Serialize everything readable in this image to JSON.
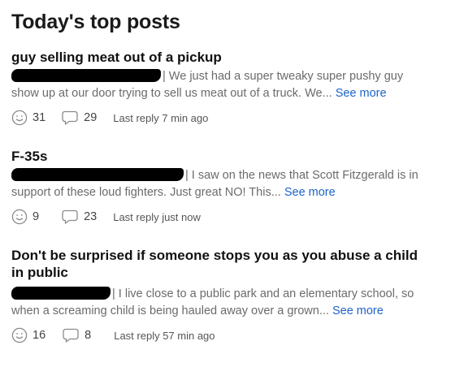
{
  "page": {
    "title": "Today's top posts"
  },
  "posts": [
    {
      "title": "guy selling meat out of a pickup",
      "separator": "|",
      "excerpt_line1": " We just had a super tweaky super pushy guy",
      "excerpt_line2": "show up at our door trying to sell us meat out of a truck. We...",
      "see_more": "See more",
      "reactions": "31",
      "comments": "29",
      "last_reply": "Last reply 7 min ago"
    },
    {
      "title": "F-35s",
      "separator": "|",
      "excerpt_line1": " I saw on the news that Scott Fitzgerald is in",
      "excerpt_line2": "support of these loud fighters. Just great NO! This...",
      "see_more": "See more",
      "reactions": "9",
      "comments": "23",
      "last_reply": "Last reply just now"
    },
    {
      "title_line1": "Don't be surprised if someone stops you as you abuse a child",
      "title_line2": "in public",
      "separator": "|",
      "excerpt_line1": " I live close to a public park and an elementary school, so",
      "excerpt_line2": "when a screaming child is being hauled away over a grown...",
      "see_more": "See more",
      "reactions": "16",
      "comments": "8",
      "last_reply": "Last reply 57 min ago"
    }
  ],
  "icons": {
    "reaction": "smiley-face-icon",
    "comment": "speech-bubble-icon"
  },
  "colors": {
    "link": "#1e63c7",
    "muted_text": "#6b6b6b",
    "icon": "#8a8a8a"
  }
}
